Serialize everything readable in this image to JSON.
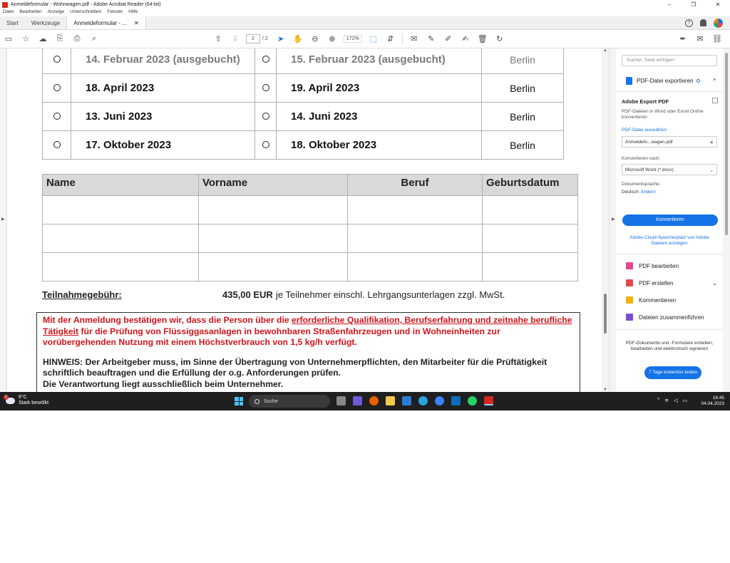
{
  "window": {
    "title": "Anmeldeformular - Wohnwagen.pdf - Adobe Acrobat Reader (64-bit)",
    "controls": [
      "–",
      "❐",
      "✕"
    ]
  },
  "menu": [
    "Datei",
    "Bearbeiten",
    "Anzeige",
    "Unterschreiben",
    "Fenster",
    "Hilfe"
  ],
  "tabs": {
    "start": "Start",
    "tools": "Werkzeuge",
    "document": "Anmeldeformular - ...",
    "close": "✕"
  },
  "toolbar": {
    "page_current": "2",
    "page_total": "/ 2",
    "zoom": "172%"
  },
  "dates_table": {
    "rows": [
      {
        "date1": "14. Februar 2023 (ausgebucht)",
        "date2": "15. Februar 2023 (ausgebucht)",
        "city": "Berlin",
        "booked": true
      },
      {
        "date1": "18. April 2023",
        "date2": "19. April 2023",
        "city": "Berlin",
        "booked": false
      },
      {
        "date1": "13. Juni 2023",
        "date2": "14. Juni 2023",
        "city": "Berlin",
        "booked": false
      },
      {
        "date1": "17. Oktober 2023",
        "date2": "18. Oktober 2023",
        "city": "Berlin",
        "booked": false
      }
    ]
  },
  "persons_table": {
    "headers": [
      "Name",
      "Vorname",
      "Beruf",
      "Geburtsdatum"
    ]
  },
  "fee": {
    "label": "Teilnahmegebühr:",
    "amount": "435,00 EUR",
    "rest": "je Teilnehmer einschl. Lehrgangsunterlagen zzgl. MwSt."
  },
  "notice": {
    "p1_a": "Mit der Anmeldung bestätigen wir, dass die Person über die ",
    "p1_link": "erforderliche Qualifikation, Berufserfahrung und zeitnahe berufliche Tätigkeit",
    "p1_b": " für die Prüfung von Flüssiggasanlagen in bewohnbaren Straßenfahrzeugen und in Wohneinheiten zur vorübergehenden Nutzung mit einem Höchstverbrauch von 1,5 kg/h verfügt.",
    "p2_line1": "HINWEIS: Der Arbeitgeber muss, im Sinne der Übertragung von Unternehmerpflichten, den Mitarbeiter für die Prüftätigkeit schriftlich beauftragen und die Erfüllung der o.g. Anforderungen prüfen.",
    "p2_line2": "Die Verantwortung liegt ausschließlich beim Unternehmer."
  },
  "right_panel": {
    "search_placeholder": "Suchen 'Seite einfügen'",
    "export_title": "PDF-Datei exportieren",
    "aep_title": "Adobe Export PDF",
    "aep_desc": "PDF-Dateien in Word oder Excel Online konvertieren",
    "select_file": "PDF-Datei auswählen",
    "file_name": "Anmeldefo...wagen.pdf",
    "convert_to_label": "Konvertieren nach",
    "convert_to_value": "Microsoft Word (*.docx)",
    "doc_lang_label": "Dokumentsprache:",
    "doc_lang_value": "Deutsch",
    "doc_lang_change": "Ändern",
    "convert_button": "Konvertieren",
    "cloud_link": "Adobe Cloud-Speicherplatz von Adobe Dateien anzeigen",
    "tools": [
      "PDF bearbeiten",
      "PDF erstellen",
      "Kommentieren",
      "Dateien zusammenführen"
    ],
    "promo": "PDF-Dokumente und -Formulare erstellen, bearbeiten und elektronisch signieren",
    "trial_button": "7 Tage kostenlos testen"
  },
  "taskbar": {
    "weather_temp": "6°C",
    "weather_desc": "Stark bewölkt",
    "weather_badge": "1",
    "search": "Suche",
    "time": "16:45",
    "date": "04.04.2023"
  }
}
